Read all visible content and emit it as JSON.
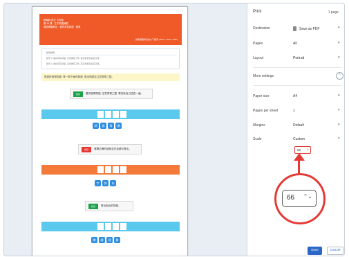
{
  "print_panel": {
    "title": "Print",
    "page_count": "1 page",
    "destination_label": "Destination",
    "destination_value": "Save as PDF",
    "pages_label": "Pages",
    "pages_value": "All",
    "layout_label": "Layout",
    "layout_value": "Portrait",
    "more_settings_label": "More settings",
    "paper_size_label": "Paper size",
    "paper_size_value": "A4",
    "pages_per_sheet_label": "Pages per sheet",
    "pages_per_sheet_value": "1",
    "margins_label": "Margins",
    "margins_value": "Default",
    "scale_label": "Scale",
    "scale_value": "Custom",
    "scale_input_value": "66",
    "save_label": "Save",
    "cancel_label": "Cancel"
  },
  "zoom_callout": {
    "value": "66"
  },
  "preview": {
    "header_line1": "統編版 語文 五年級",
    "header_line2": "第 16 課 · 生字詞語練習",
    "header_line3": "閱讀理解題目 · 看拼音寫詞語 · 積累",
    "header_right": "請按照要求完成以下練習 (Name, Class, Date)",
    "info_title": "練習說明",
    "info_row1": "練習 1:    讀拼音寫詞語, 注意書寫工整, 寫完後檢查是否正確。",
    "info_row2": "練習 2:    讀拼音寫詞語, 注意書寫工整, 寫完後檢查是否正確。",
    "instruction": "根據拼音寫詞語, 寫一寫下面的詞語, 寫出詞語並注意書寫工整。",
    "q1_tag": "題目",
    "q1_text": "看拼音寫詞語, 注意書寫工整, 寫完後自己檢查一遍。",
    "q2_tag": "題目",
    "q2_text": "選擇正確的讀音並在括號中寫出。",
    "q3_tag": "題目",
    "q3_text": "寫出相近的詞語。",
    "band_pills_1": [
      "詞",
      "語",
      "寫",
      "讀"
    ],
    "band_pills_2": [
      "字",
      "詞",
      "句"
    ],
    "band_pills_3": [
      "閱",
      "讀",
      "理",
      "解"
    ]
  },
  "colors": {
    "header_orange": "#ef5a28",
    "band_blue": "#5bc8ee",
    "band_orange": "#f47a3a",
    "pill_blue": "#2f8de0",
    "tag_green": "#1fa34a",
    "tag_red": "#e53935",
    "highlight_yellow": "#fdf6c9",
    "accent_red": "#e53935",
    "save_blue": "#2b67c7"
  }
}
